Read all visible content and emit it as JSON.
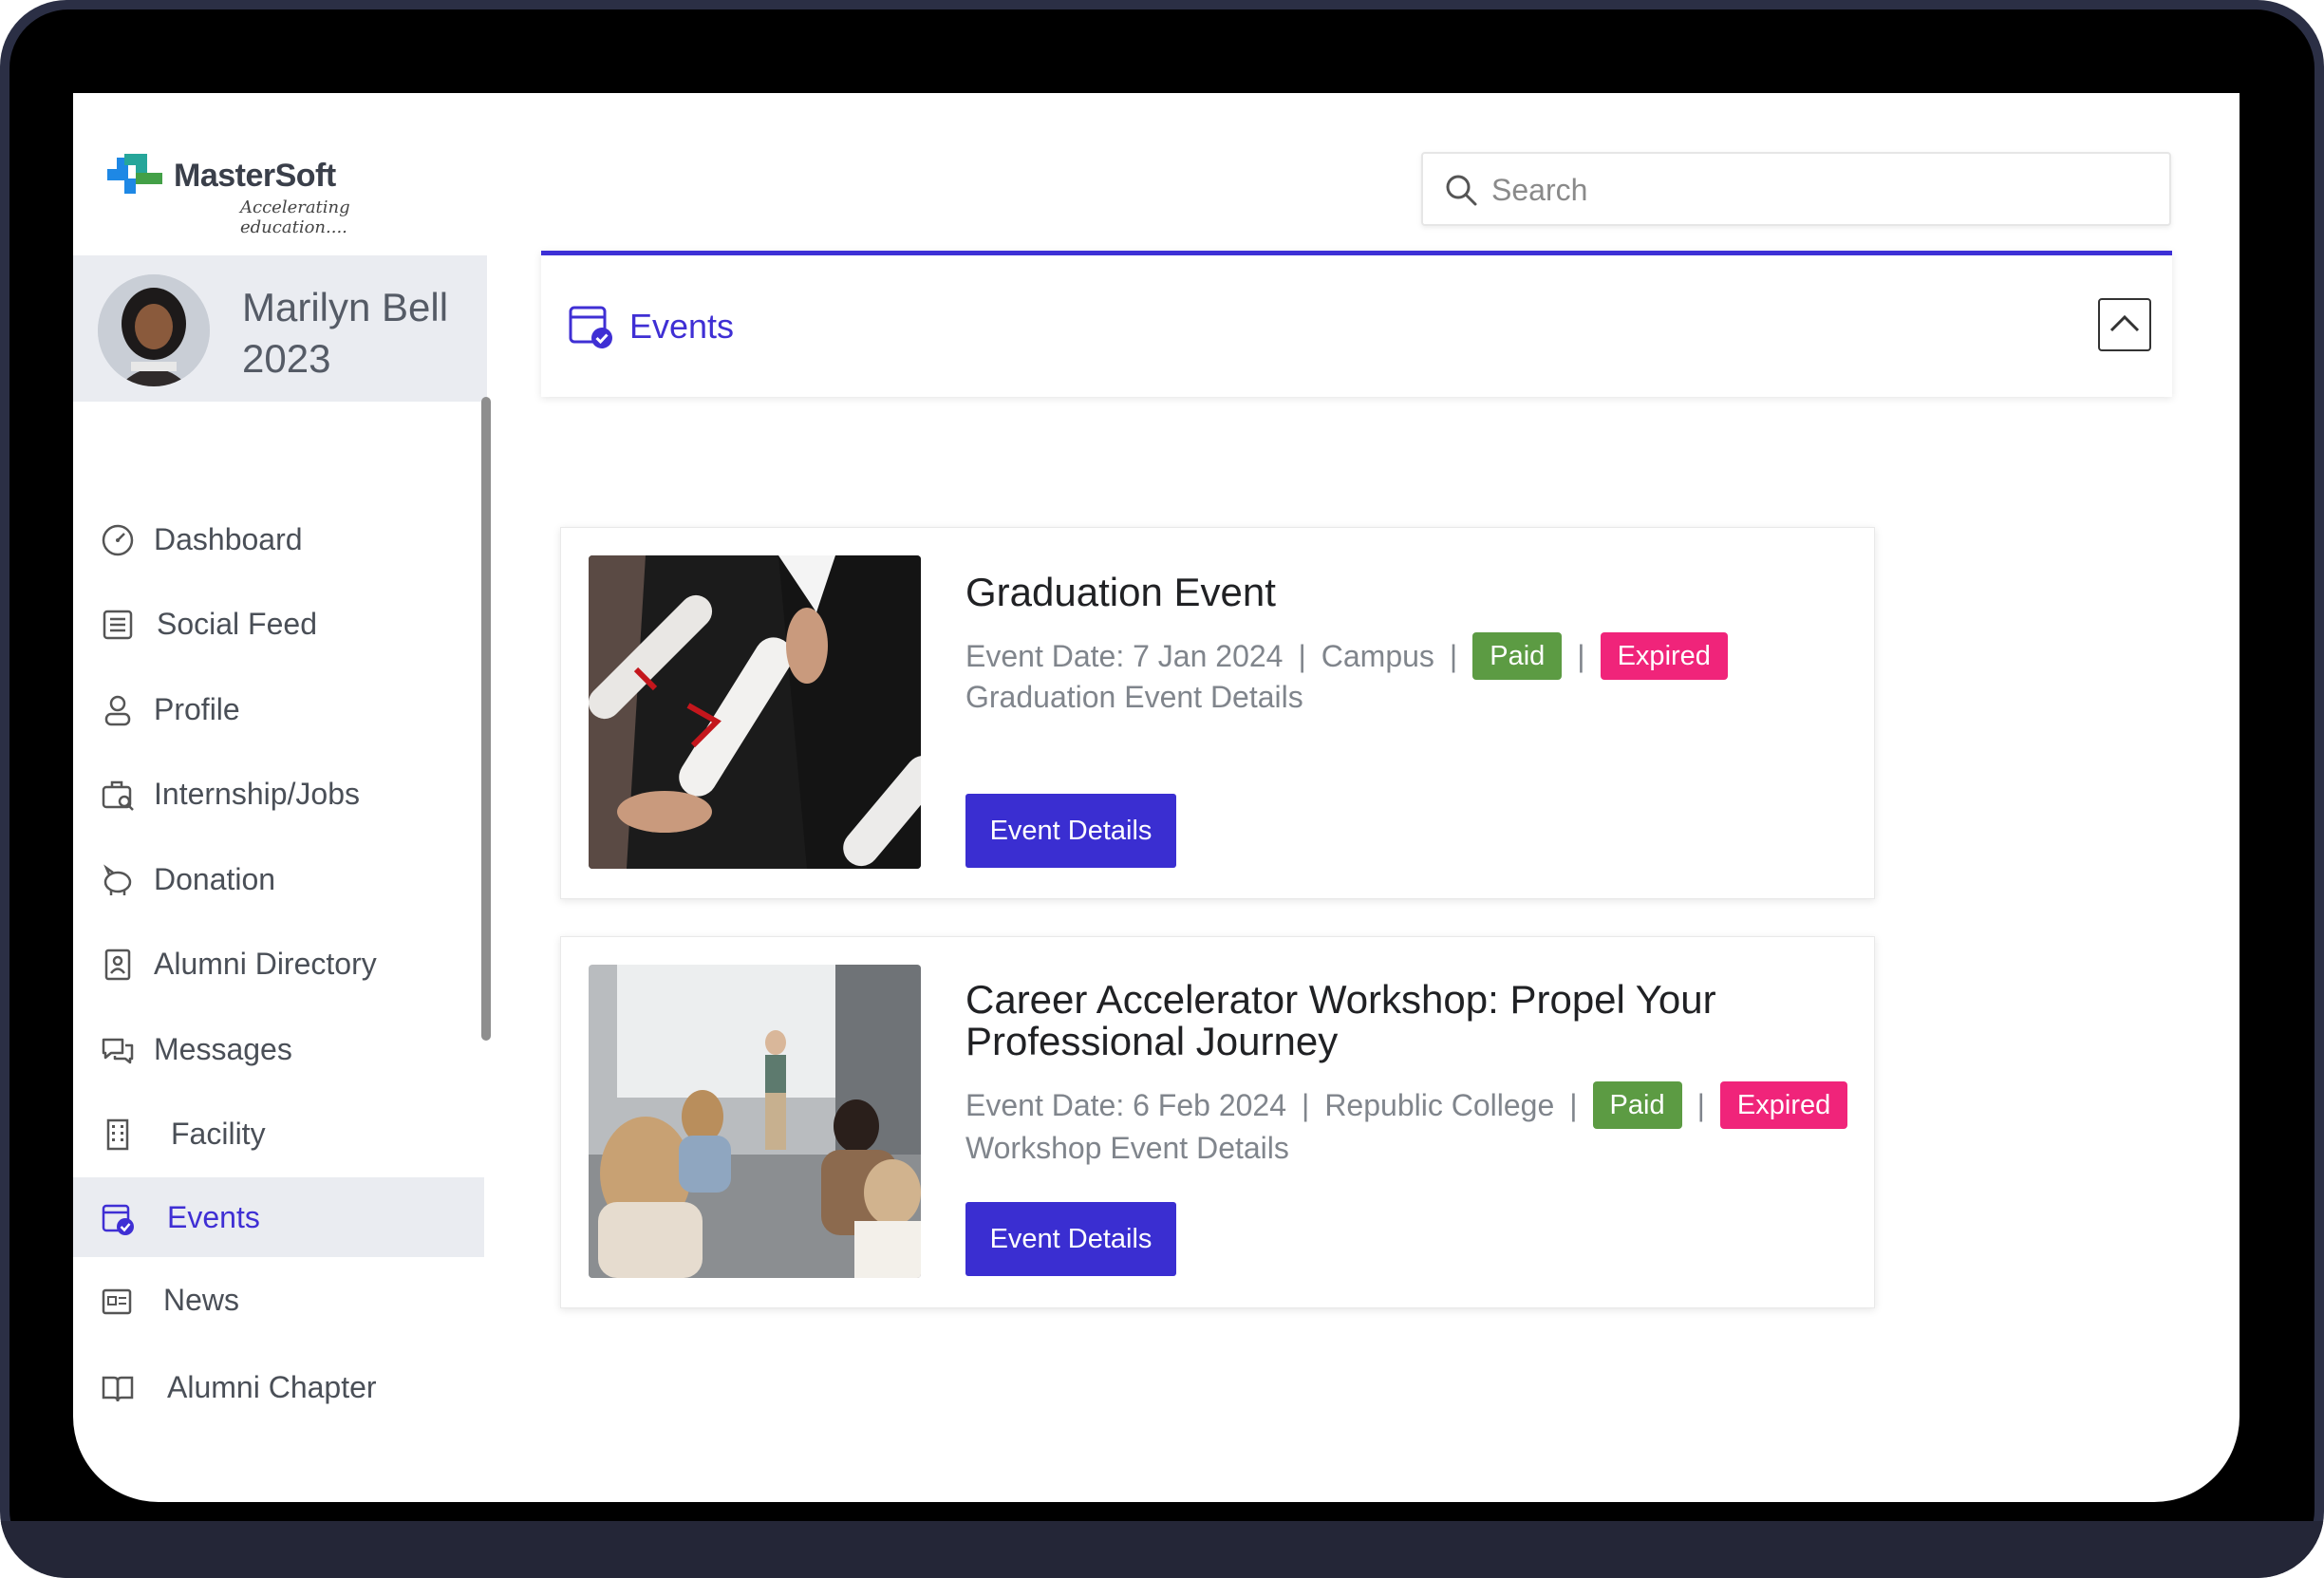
{
  "brand": {
    "name": "MasterSoft",
    "tagline": "Accelerating education....",
    "colors": {
      "blue": "#1e88e5",
      "green": "#43a047",
      "teal": "#26a69a"
    }
  },
  "search": {
    "placeholder": "Search",
    "value": ""
  },
  "user": {
    "name_line1": "Marilyn Bell",
    "name_line2": "2023"
  },
  "sidebar": {
    "items": [
      {
        "label": "Dashboard",
        "icon": "dashboard-gauge-icon",
        "active": false
      },
      {
        "label": "Social Feed",
        "icon": "list-document-icon",
        "active": false
      },
      {
        "label": "Profile",
        "icon": "user-icon",
        "active": false
      },
      {
        "label": "Internship/Jobs",
        "icon": "briefcase-search-icon",
        "active": false
      },
      {
        "label": "Donation",
        "icon": "piggy-bank-icon",
        "active": false
      },
      {
        "label": "Alumni Directory",
        "icon": "contact-book-icon",
        "active": false
      },
      {
        "label": "Messages",
        "icon": "chat-bubbles-icon",
        "active": false
      },
      {
        "label": "Facility",
        "icon": "building-icon",
        "active": false
      },
      {
        "label": "Events",
        "icon": "calendar-check-icon",
        "active": true
      },
      {
        "label": "News",
        "icon": "newspaper-icon",
        "active": false
      },
      {
        "label": "Alumni Chapter",
        "icon": "open-book-icon",
        "active": false
      }
    ]
  },
  "events_section": {
    "title": "Events",
    "collapse_icon": "chevron-up-icon",
    "accent": "#3d30d6"
  },
  "events": [
    {
      "title": "Graduation Event",
      "date": "Event Date: 7 Jan 2024",
      "location": "Campus",
      "badges": [
        "Paid",
        "Expired"
      ],
      "description": "Graduation Event Details",
      "button": "Event Details"
    },
    {
      "title": "Career Accelerator Workshop: Propel Your Professional Journey",
      "date": "Event Date: 6 Feb 2024",
      "location": "Republic College",
      "badges": [
        "Paid",
        "Expired"
      ],
      "description": "Workshop Event Details",
      "button": "Event Details"
    }
  ]
}
